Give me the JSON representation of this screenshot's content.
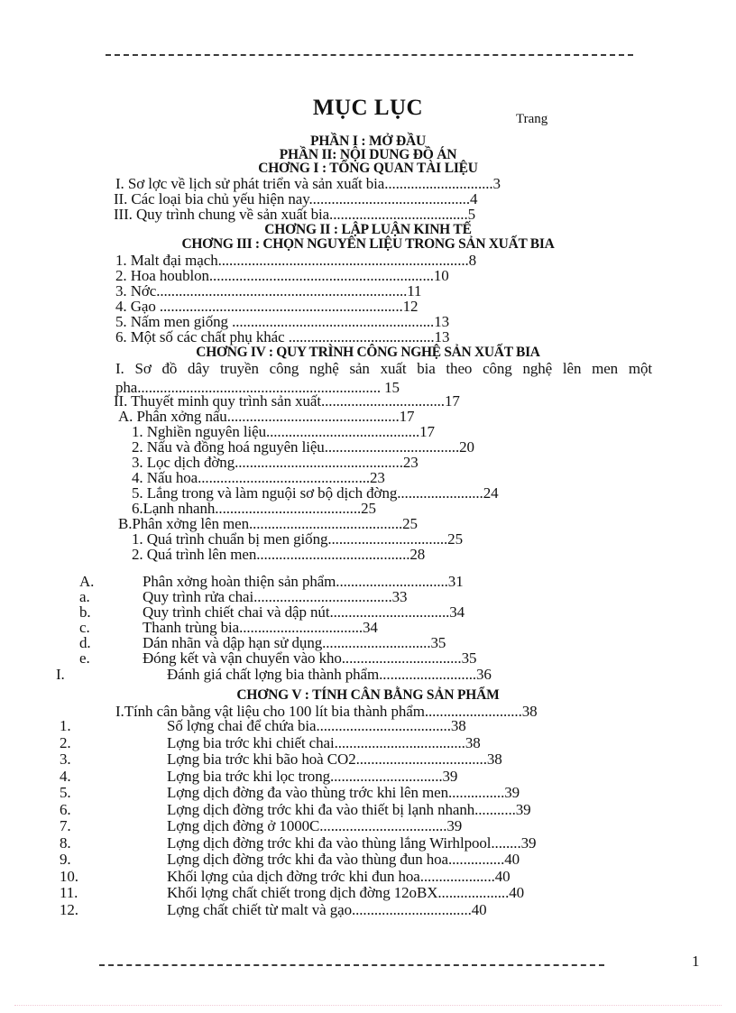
{
  "document": {
    "title": "MỤC LỤC",
    "page_column_label": "Trang",
    "page_number": "1"
  },
  "headings": {
    "part1": "PHẦN I : MỞ ĐẦU",
    "part2": "PHẦN II: NỘI DUNG ĐỒ ÁN",
    "chapter1": "CHƠNG   I : TỔNG QUAN TÀI LIỆU",
    "chapter2": "CHƠNG   II : LẬP LUẬN KINH TẾ",
    "chapter3": "CHƠNG   III : CHỌN NGUYÊN LIỆU TRONG SẢN XUẤT BIA",
    "chapter4": "CHƠNG   IV : QUY TRÌNH CÔNG NGHỆ SẢN XUẤT BIA",
    "chapter5": "CHƠNG   V : TÍNH CÂN BẰNG SẢN PHẨM"
  },
  "entries": {
    "e1": "I. Sơ lợc   về lịch sử phát triển và sản xuất bia.............................3",
    "e2": "II. Các loại bia chủ yếu hiện nay...........................................4",
    "e3": "III. Quy trình chung về sản xuất bia.....................................5",
    "e4": "1. Malt đại mạch...................................................................8",
    "e5": "2.  Hoa houblon............................................................10",
    "e6": "3. Nớc...................................................................11",
    "e7": "4. Gạo .................................................................12",
    "e8": "5.  Nấm men giống ......................................................13",
    "e9": "6. Một số các chất phụ khác .......................................13",
    "e10_line1": "I. Sơ đồ dây truyền công nghệ sản xuất bia theo công nghệ lên men một",
    "e10_line2": "pha................................................................. 15",
    "e11": "II. Thuyết minh quy trình sản xuất.................................17",
    "e12": " A. Phân xởng   nấu..............................................17",
    "e13": "1. Nghiền nguyên liệu.........................................17",
    "e14": "2.  Nấu và đồng   hoá nguyên liệu....................................20",
    "e15": "3. Lọc dịch đờng.............................................23",
    "e16": "4. Nấu hoa..............................................23",
    "e17": "5. Lắng trong và làm nguội sơ bộ dịch đờng.......................24",
    "e18": "6.Lạnh nhanh.......................................25",
    "e19": "B.Phân xởng   lên men.........................................25",
    "e20": "1. Quá trình chuẩn bị men giống................................25",
    "e21": "2.  Quá trình lên men.........................................28",
    "e22": "I.Tính cân bằng vật liệu cho 100 lít bia thành phẩm..........................38"
  },
  "lettered_rows": [
    {
      "marker": "A.",
      "text": "Phân xởng   hoàn thiện sản phẩm..............................31"
    },
    {
      "marker": "a.",
      "text": "Quy trình rửa chai.....................................33"
    },
    {
      "marker": "b.",
      "text": "Quy trình chiết chai và dập nút................................34"
    },
    {
      "marker": "c.",
      "text": "Thanh trùng bia.................................34"
    },
    {
      "marker": "d.",
      "text": "Dán nhãn và dập hạn sử dụng.............................35"
    },
    {
      "marker": "e.",
      "text": "Đóng kết và vận chuyển vào kho................................35"
    },
    {
      "marker": "I.",
      "text": "Đánh giá chất lợng   bia thành phẩm..........................36"
    }
  ],
  "numbered_rows": [
    {
      "marker": "1.",
      "text": "Số lợng   chai để chứa bia....................................38"
    },
    {
      "marker": "2.",
      "text": "Lợng   bia trớc   khi chiết chai...................................38"
    },
    {
      "marker": "3.",
      "text": "Lợng   bia trớc   khi bão hoà CO2...................................38"
    },
    {
      "marker": "4.",
      "text": "Lợng   bia trớc   khi lọc trong..............................39"
    },
    {
      "marker": "5.",
      "text": "Lợng   dịch đờng   đa   vào thùng trớc   khi lên men...............39"
    },
    {
      "marker": "6.",
      "text": "Lợng   dịch đờng   trớc   khi đa   vào thiết bị lạnh nhanh...........39"
    },
    {
      "marker": "7.",
      "text": "Lợng   dịch đờng   ở 1000C..................................39"
    },
    {
      "marker": "8.",
      "text": "Lợng   dịch đờng   trớc   khi đa   vào thùng lắng Wirhlpool........39"
    },
    {
      "marker": "9.",
      "text": "Lợng   dịch đờng   trớc   khi đa   vào thùng đun hoa...............40"
    },
    {
      "marker": "10.",
      "text": "Khối lợng   của dịch đờng   trớc   khi đun hoa....................40"
    },
    {
      "marker": "11.",
      "text": "Khối lợng   chất chiết trong dịch đờng   12oBX...................40"
    },
    {
      "marker": "12.",
      "text": "Lợng   chất chiết từ malt và gạo................................40"
    }
  ]
}
